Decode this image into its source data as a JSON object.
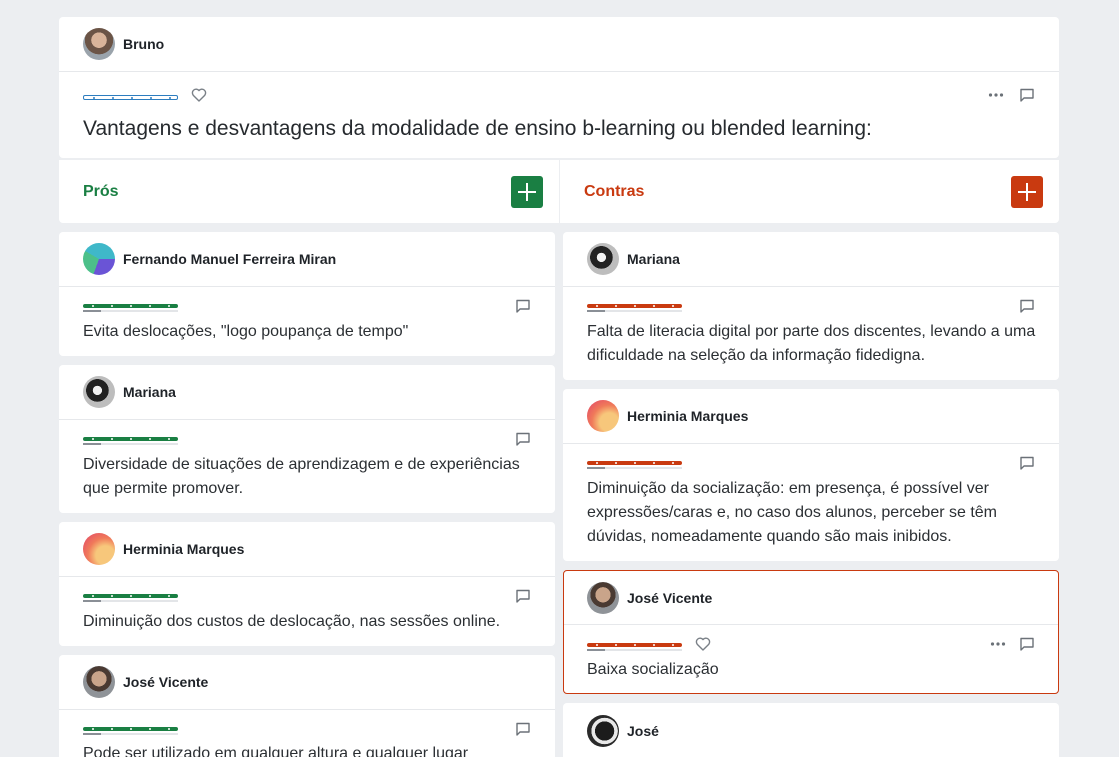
{
  "topic": {
    "author": "Bruno",
    "title": "Vantagens e desvantagens da modalidade de ensino b-learning ou blended learning:"
  },
  "columns": {
    "pros": {
      "title": "Prós",
      "color": "#1a7f43"
    },
    "cons": {
      "title": "Contras",
      "color": "#c93a10"
    }
  },
  "pros_items": [
    {
      "author": "Fernando Manuel Ferreira Miran",
      "text": "Evita deslocações, \"logo poupança de tempo\""
    },
    {
      "author": "Mariana",
      "text": "Diversidade de situações de aprendizagem e de experiências que permite promover."
    },
    {
      "author": "Herminia Marques",
      "text": "Diminuição dos custos de deslocação, nas sessões online."
    },
    {
      "author": "José Vicente",
      "text": "Pode ser utilizado em qualquer altura e qualquer lugar"
    }
  ],
  "cons_items": [
    {
      "author": "Mariana",
      "text": "Falta de literacia digital por parte dos discentes, levando a uma dificuldade na seleção da informação fidedigna."
    },
    {
      "author": "Herminia Marques",
      "text": "Diminuição da socialização: em presença, é possível ver expressões/caras e, no caso dos alunos, perceber se têm dúvidas, nomeadamente quando são mais inibidos."
    },
    {
      "author": "José Vicente",
      "text": "Baixa socialização",
      "selected": true
    },
    {
      "author": "José",
      "text": ""
    }
  ],
  "icons": [
    "heart-icon",
    "more-icon",
    "comment-icon",
    "plus-icon"
  ]
}
